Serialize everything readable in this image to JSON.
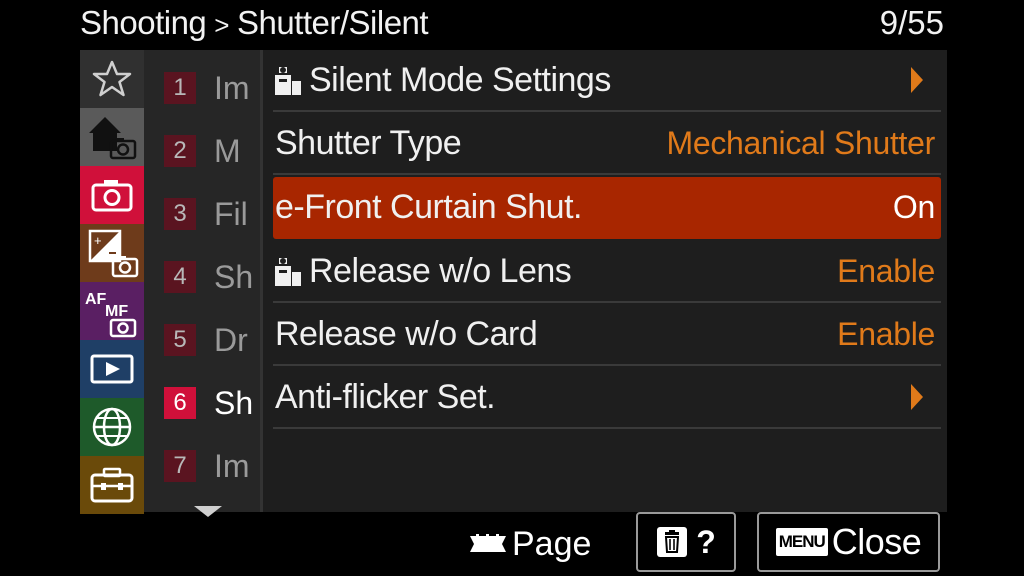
{
  "header": {
    "section": "Shooting",
    "separator": ">",
    "subsection": "Shutter/Silent",
    "page_counter": "9/55"
  },
  "categories": [
    {
      "icon": "star-icon",
      "label": "My Menu",
      "color": "#303030"
    },
    {
      "icon": "home-camera-icon",
      "label": "Main",
      "color": "#5a5a5a"
    },
    {
      "icon": "camera-icon",
      "label": "Shooting",
      "color": "#d0103a"
    },
    {
      "icon": "exposure-icon",
      "label": "Exposure/Color",
      "color": "#6e3b1b"
    },
    {
      "icon": "af-mf-icon",
      "label": "Focus",
      "color": "#5a1f63"
    },
    {
      "icon": "playback-icon",
      "label": "Playback",
      "color": "#1f3f66"
    },
    {
      "icon": "globe-icon",
      "label": "Network",
      "color": "#1e5a2a"
    },
    {
      "icon": "toolbox-icon",
      "label": "Setup",
      "color": "#6a4a0a"
    }
  ],
  "sub_tabs": [
    {
      "num": "1",
      "text": "Im"
    },
    {
      "num": "2",
      "text": "M"
    },
    {
      "num": "3",
      "text": "Fil"
    },
    {
      "num": "4",
      "text": "Sh"
    },
    {
      "num": "5",
      "text": "Dr"
    },
    {
      "num": "6",
      "text": "Sh",
      "active": true
    },
    {
      "num": "7",
      "text": "Im"
    }
  ],
  "menu_items": [
    {
      "label": "Silent Mode Settings",
      "value": "",
      "has_still_icon": true,
      "has_arrow": true
    },
    {
      "label": "Shutter Type",
      "value": "Mechanical Shutter"
    },
    {
      "label": "e-Front Curtain Shut.",
      "value": "On",
      "selected": true
    },
    {
      "label": "Release w/o Lens",
      "value": "Enable",
      "has_still_icon": true
    },
    {
      "label": "Release w/o Card",
      "value": "Enable"
    },
    {
      "label": "Anti-flicker Set.",
      "value": "",
      "has_arrow": true
    }
  ],
  "footer": {
    "page_label": "Page",
    "help_label": "?",
    "menu_badge": "MENU",
    "close_label": "Close"
  },
  "colors": {
    "selected_row": "#a82600",
    "value_text": "#e07a1a",
    "active_tab": "#d0103a"
  }
}
